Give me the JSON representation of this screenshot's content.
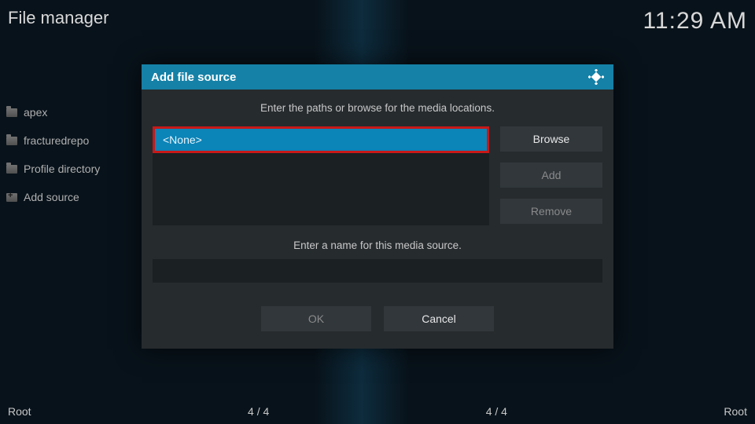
{
  "header": {
    "title": "File manager",
    "clock": "11:29 AM"
  },
  "sidebar": {
    "items": [
      {
        "label": "apex"
      },
      {
        "label": "fracturedrepo"
      },
      {
        "label": "Profile directory"
      },
      {
        "label": "Add source"
      }
    ]
  },
  "dialog": {
    "title": "Add file source",
    "instruction_paths": "Enter the paths or browse for the media locations.",
    "path_value": "<None>",
    "browse_label": "Browse",
    "add_label": "Add",
    "remove_label": "Remove",
    "instruction_name": "Enter a name for this media source.",
    "name_value": "",
    "ok_label": "OK",
    "cancel_label": "Cancel"
  },
  "footer": {
    "left_label": "Root",
    "left_count": "4 / 4",
    "right_count": "4 / 4",
    "right_label": "Root"
  }
}
